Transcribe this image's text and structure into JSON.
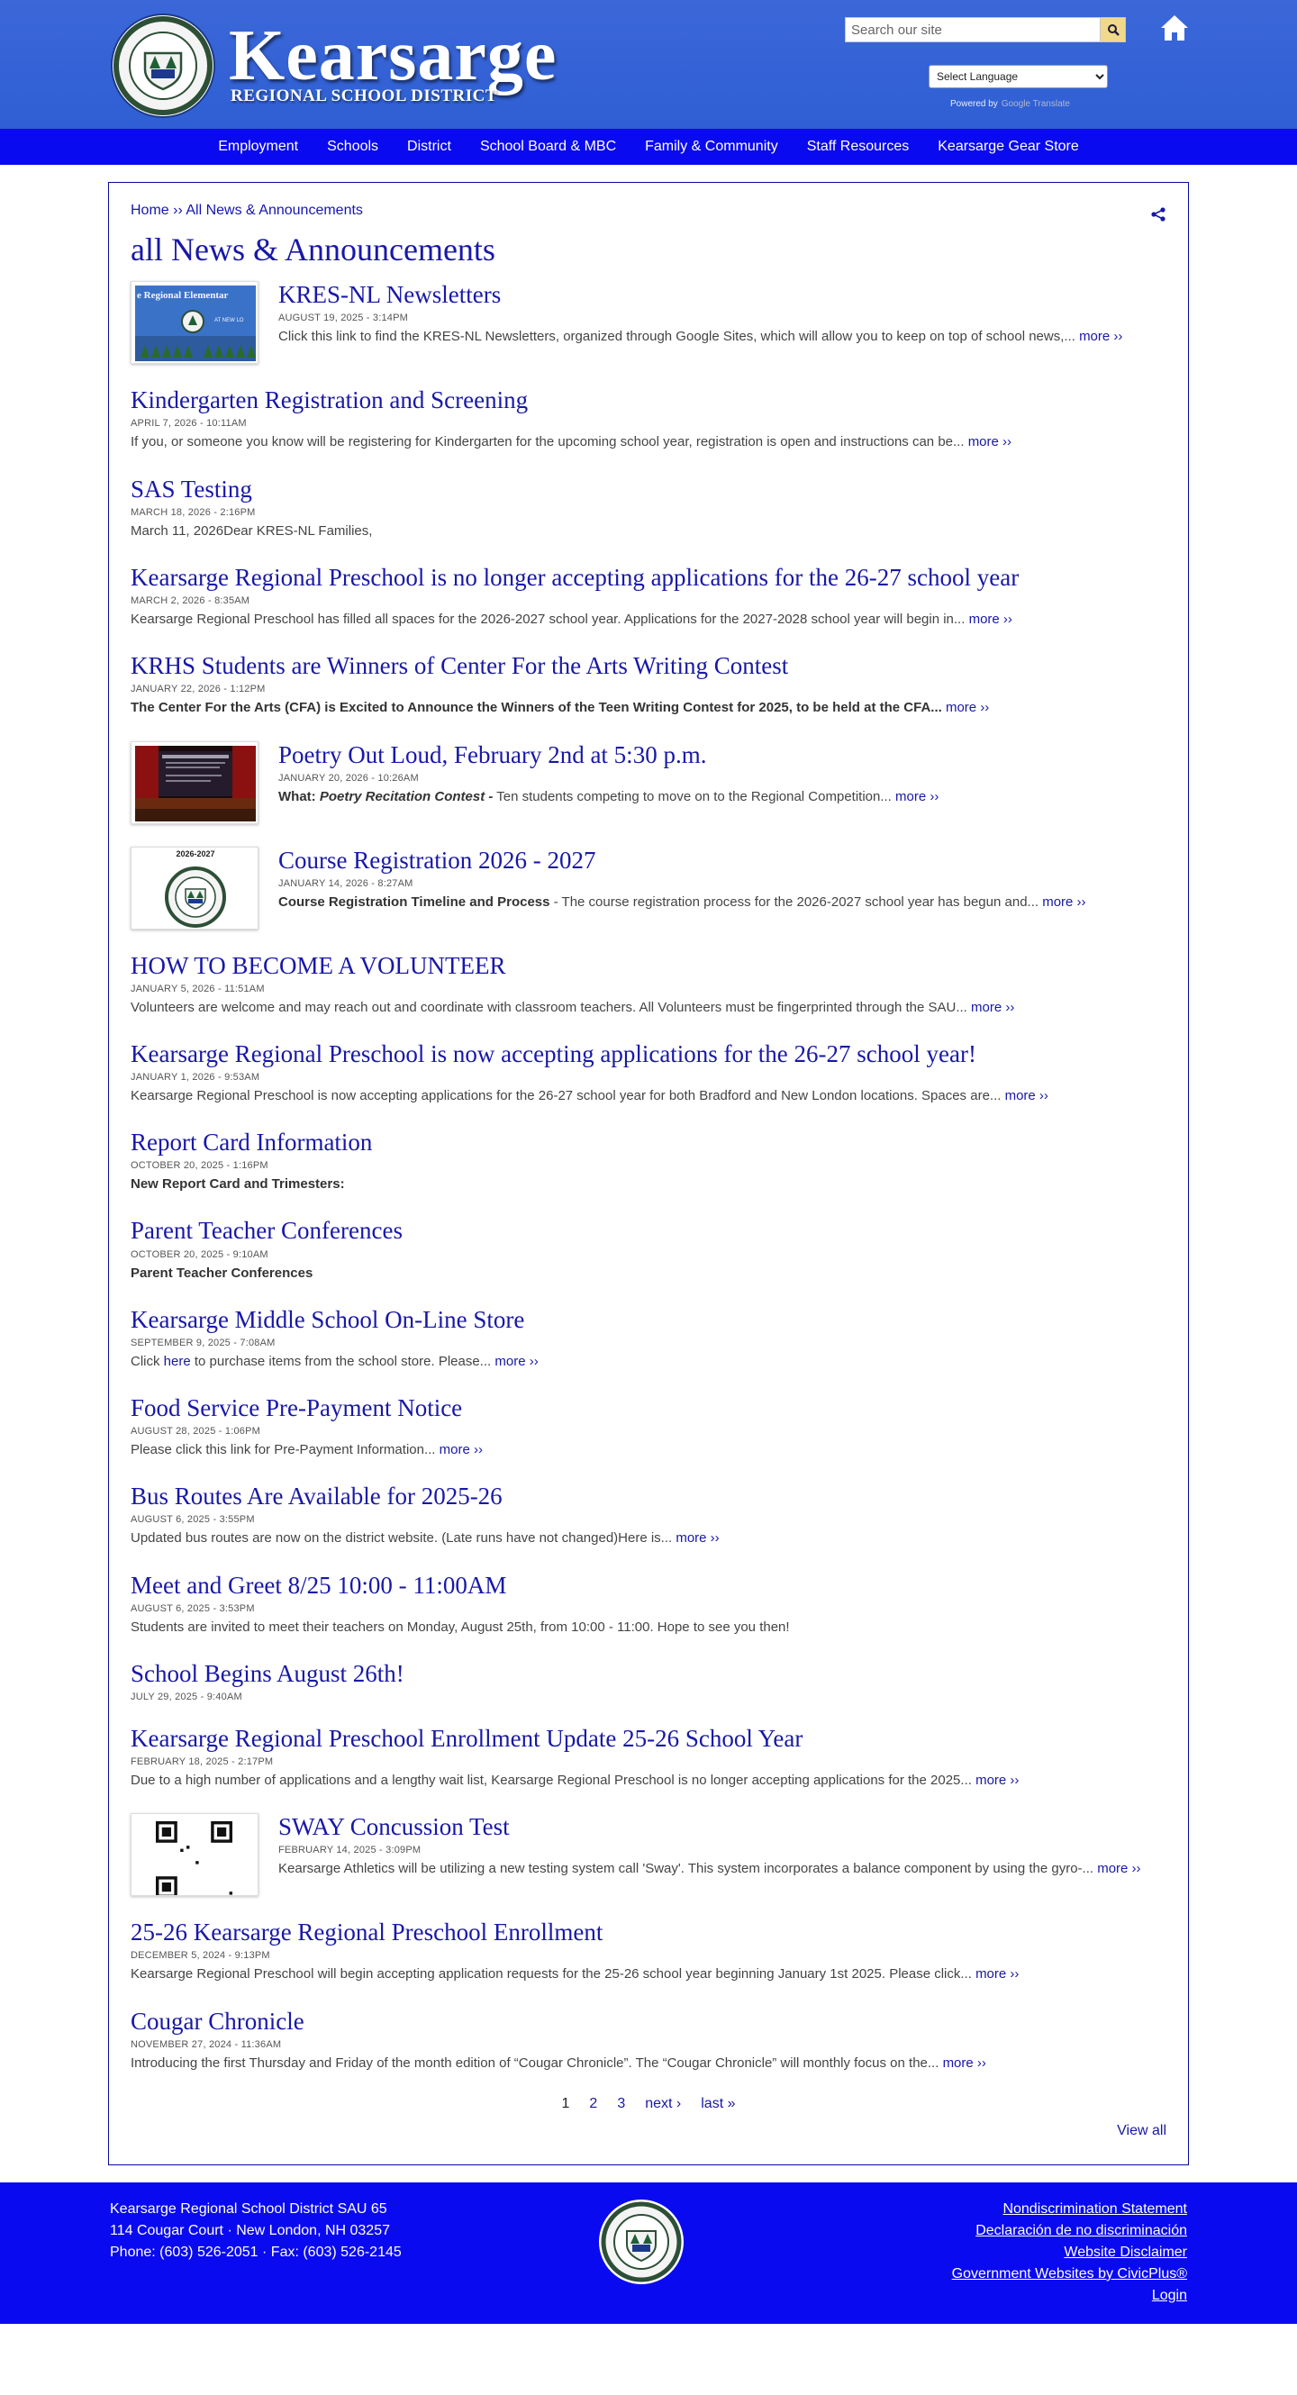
{
  "header": {
    "brand_name": "Kearsarge",
    "brand_subtitle": "REGIONAL SCHOOL DISTRICT",
    "search_placeholder": "Search our site",
    "language_select": "Select Language",
    "powered_by": "Powered by",
    "powered_by_service": "Google Translate",
    "colors": {
      "header_bg": "#3b67d8",
      "nav_bg": "#0a0af0",
      "link": "#1818a8"
    }
  },
  "nav": {
    "items": [
      "Employment",
      "Schools",
      "District",
      "School Board & MBC",
      "Family & Community",
      "Staff Resources",
      "Kearsarge Gear Store"
    ]
  },
  "breadcrumb": {
    "home": "Home",
    "separator": "››",
    "current": "All News & Announcements"
  },
  "page_title": "all News & Announcements",
  "news": [
    {
      "title": "KRES-NL Newsletters",
      "date": "AUGUST 19, 2025 - 3:14PM",
      "summary": "Click this link to find the KRES-NL Newsletters, organized through Google Sites, which will allow you to keep on top of school news,...",
      "more": "more ››",
      "thumb": "kres-banner-image"
    },
    {
      "title": "Kindergarten Registration and Screening",
      "date": "APRIL 7, 2026 - 10:11AM",
      "summary": "If you, or someone you know will be registering for Kindergarten for the upcoming school year, registration is open and instructions can be...",
      "more": "more ››"
    },
    {
      "title": "SAS Testing",
      "date": "MARCH 18, 2026 - 2:16PM",
      "summary": "March 11, 2026Dear KRES-NL Families,",
      "more": ""
    },
    {
      "title": "Kearsarge Regional Preschool is no longer accepting applications for the 26-27 school year",
      "date": "MARCH 2, 2026 - 8:35AM",
      "summary": "Kearsarge Regional Preschool has filled all spaces for the 2026-2027 school year. Applications for the 2027-2028 school year will begin in...",
      "more": "more ››"
    },
    {
      "title": "KRHS Students are Winners of Center For the Arts Writing Contest",
      "date": "JANUARY 22, 2026 - 1:12PM",
      "summary_bold": " The Center For the Arts (CFA) is Excited to Announce the Winners of the Teen Writing Contest for 2025, to be held at the CFA...",
      "summary": "",
      "more": "more ››"
    },
    {
      "title": "Poetry Out Loud, February 2nd at 5:30 p.m.",
      "date": "JANUARY 20, 2026 - 10:26AM",
      "summary_bold": "What: ",
      "summary_bolditalic": "Poetry Recitation Contest -",
      "summary": " Ten students competing to move on to the Regional Competition...",
      "more": "more ››",
      "thumb": "poetry-stage-image"
    },
    {
      "title": "Course Registration 2026 - 2027",
      "date": "JANUARY 14, 2026 - 8:27AM",
      "summary_bold": "Course Registration Timeline and Process",
      "summary": " - The course registration process for the 2026-2027 school year has begun and...",
      "more": "more ››",
      "thumb": "course-seal-image",
      "thumb_caption": "2026-2027"
    },
    {
      "title": "HOW TO BECOME A VOLUNTEER",
      "date": "JANUARY 5, 2026 - 11:51AM",
      "summary": "Volunteers are welcome and may reach out and coordinate with classroom teachers. All Volunteers must be fingerprinted through the SAU...",
      "more": "more ››"
    },
    {
      "title": "Kearsarge Regional Preschool is now accepting applications for the 26-27 school year!",
      "date": "JANUARY 1, 2026 - 9:53AM",
      "summary": "Kearsarge Regional Preschool is now accepting applications for the 26-27 school year for both Bradford and New London locations. Spaces are...",
      "more": "more ››"
    },
    {
      "title": "Report Card Information",
      "date": "OCTOBER 20, 2025 - 1:16PM",
      "summary_bold": "New Report Card and Trimesters:",
      "summary": "",
      "more": ""
    },
    {
      "title": "Parent Teacher Conferences",
      "date": "OCTOBER 20, 2025 - 9:10AM",
      "summary_bold": "Parent Teacher Conferences",
      "summary": "",
      "more": ""
    },
    {
      "title": "Kearsarge Middle School On-Line Store",
      "date": "SEPTEMBER 9, 2025 - 7:08AM",
      "summary_pre": "Click ",
      "summary_link": "here",
      "summary": " to purchase items from the school store.  Please...",
      "more": "more ››"
    },
    {
      "title": "Food Service Pre-Payment Notice",
      "date": "AUGUST 28, 2025 - 1:06PM",
      "summary": "Please click this link for Pre-Payment Information...",
      "more": "more ››"
    },
    {
      "title": "Bus Routes Are Available for 2025-26",
      "date": "AUGUST 6, 2025 - 3:55PM",
      "summary": "Updated bus routes are now on the district website.  (Late runs have not changed)Here is...",
      "more": "more ››"
    },
    {
      "title": "Meet and Greet 8/25 10:00 - 11:00AM",
      "date": "AUGUST 6, 2025 - 3:53PM",
      "summary": "Students are invited to meet their teachers on Monday, August 25th, from 10:00 - 11:00.  Hope to see you then!",
      "more": ""
    },
    {
      "title": "School Begins August 26th!",
      "date": "JULY 29, 2025 - 9:40AM",
      "summary": "",
      "more": ""
    },
    {
      "title": "Kearsarge Regional Preschool Enrollment Update 25-26 School Year",
      "date": "FEBRUARY 18, 2025 - 2:17PM",
      "summary": "Due to a high number of applications and a lengthy wait list, Kearsarge Regional Preschool is no longer accepting applications for the 2025...",
      "more": "more ››"
    },
    {
      "title": "SWAY Concussion Test",
      "date": "FEBRUARY 14, 2025 - 3:09PM",
      "summary": "Kearsarge Athletics will be utilizing a new testing system call 'Sway'. This system incorporates a balance component by using the gyro-...",
      "more": "more ››",
      "thumb": "qr-code-image"
    },
    {
      "title": "25-26 Kearsarge Regional Preschool Enrollment",
      "date": "DECEMBER 5, 2024 - 9:13PM",
      "summary": "Kearsarge Regional Preschool will begin accepting application requests for the 25-26 school year beginning January 1st 2025. Please click...",
      "more": "more ››"
    },
    {
      "title": "Cougar Chronicle",
      "date": "NOVEMBER 27, 2024 - 11:36AM",
      "summary": "Introducing the first Thursday and Friday of the month edition of “Cougar Chronicle”. The “Cougar Chronicle” will monthly focus on the...",
      "more": "more ››"
    }
  ],
  "pagination": {
    "pages": [
      "1",
      "2",
      "3"
    ],
    "current": "1",
    "next": "next ›",
    "last": "last »"
  },
  "view_all": "View all",
  "thumb_text": {
    "kres_banner": "e Regional Elementar",
    "kres_banner_right": "AT NEW LO"
  },
  "footer": {
    "address_lines": [
      "Kearsarge Regional School District SAU 65",
      "114 Cougar Court · New London, NH 03257",
      "Phone: (603) 526-2051 · Fax: (603) 526-2145"
    ],
    "links": [
      "Nondiscrimination Statement",
      "Declaración de no discriminación",
      "Website Disclaimer",
      "Government Websites by CivicPlus®",
      "Login"
    ]
  }
}
